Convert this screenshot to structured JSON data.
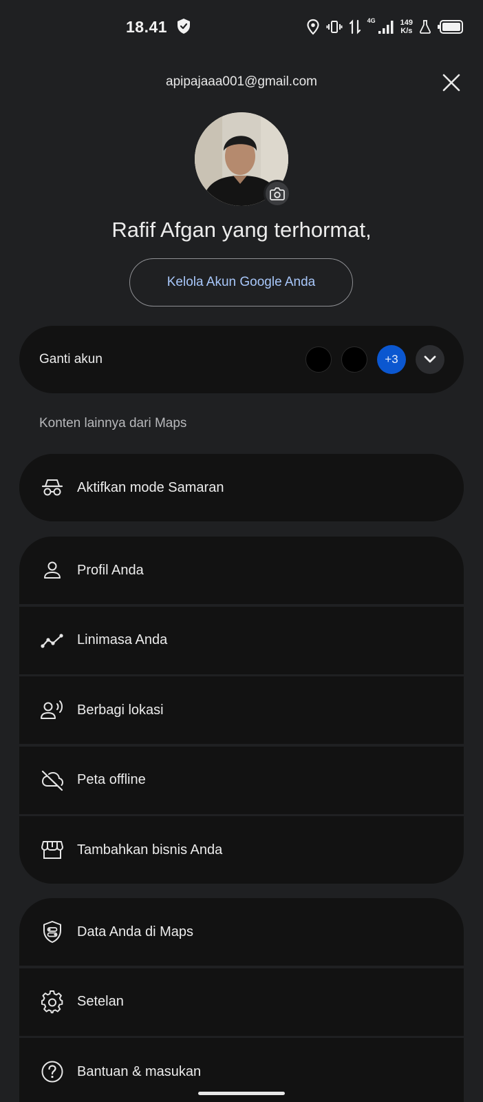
{
  "status_bar": {
    "time": "18.41",
    "network_type": "4G",
    "speed_value": "149",
    "speed_unit": "K/s"
  },
  "header": {
    "email": "apipajaaa001@gmail.com",
    "close_icon": "close-icon"
  },
  "profile": {
    "greeting": "Rafif Afgan yang terhormat,",
    "camera_icon": "camera-icon",
    "manage_label": "Kelola Akun Google Anda"
  },
  "switch_account": {
    "label": "Ganti akun",
    "more_count": "+3"
  },
  "section_title": "Konten lainnya dari Maps",
  "menu": {
    "incognito": {
      "label": "Aktifkan mode Samaran",
      "icon": "incognito-icon"
    },
    "group1": [
      {
        "label": "Profil Anda",
        "icon": "person-icon"
      },
      {
        "label": "Linimasa Anda",
        "icon": "timeline-icon"
      },
      {
        "label": "Berbagi lokasi",
        "icon": "location-sharing-icon"
      },
      {
        "label": "Peta offline",
        "icon": "cloud-off-icon"
      },
      {
        "label": "Tambahkan bisnis Anda",
        "icon": "storefront-icon"
      }
    ],
    "group2": [
      {
        "label": "Data Anda di Maps",
        "icon": "shield-data-icon"
      },
      {
        "label": "Setelan",
        "icon": "gear-icon"
      },
      {
        "label": "Bantuan & masukan",
        "icon": "help-icon"
      }
    ]
  },
  "colors": {
    "background": "#1f2022",
    "card": "#121212",
    "link": "#a8c7fa",
    "accent_badge": "#0b57d0"
  }
}
